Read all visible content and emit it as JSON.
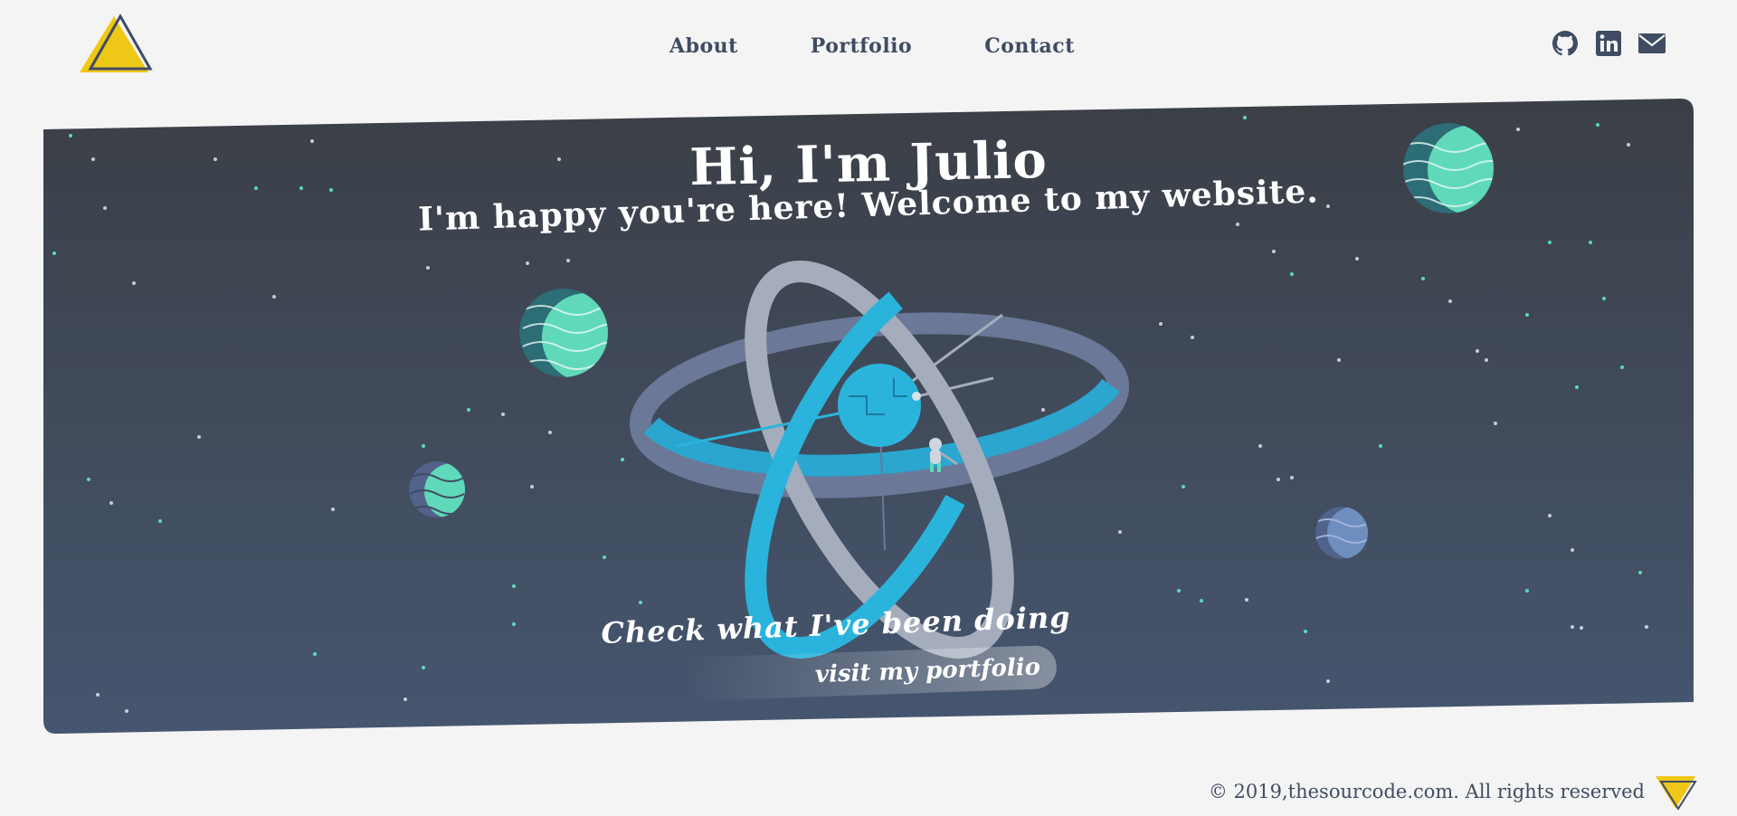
{
  "nav": {
    "links": [
      "About",
      "Portfolio",
      "Contact"
    ]
  },
  "header": {
    "logo_icon": "triangle-logo",
    "social": [
      {
        "icon": "github-icon"
      },
      {
        "icon": "linkedin-icon"
      },
      {
        "icon": "email-icon"
      }
    ]
  },
  "hero": {
    "title": "Hi, I'm Julio",
    "subtitle": "I'm happy you're here! Welcome to my website.",
    "cta_heading": "Check what I've been doing",
    "cta_button": "visit my portfolio"
  },
  "footer": {
    "copyright": "© 2019,thesourcode.com. All rights reserved"
  },
  "colors": {
    "accent_yellow": "#efc716",
    "navy": "#3f4c63",
    "hero_top": "#3b3f46",
    "hero_bottom": "#465670",
    "teal": "#5fd9b9",
    "cyan": "#2ab4dc"
  }
}
